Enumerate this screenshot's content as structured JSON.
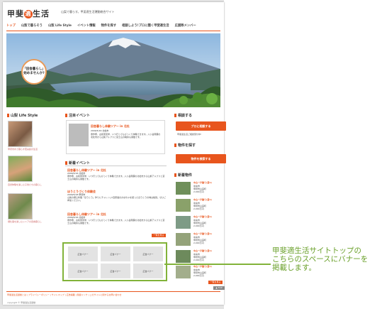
{
  "site": {
    "logo_text": "甲斐適生活",
    "logo_dot_char": "適",
    "tagline": "山梨で暮らす。甲斐適生活運動総合サイト"
  },
  "nav": [
    "トップ",
    "山梨で暮らそう",
    "山梨 Life Style",
    "イベント情報",
    "物件を探す",
    "相談しよう!プロに聞く甲斐適生活",
    "広援隊メンバー"
  ],
  "hero": {
    "badge_line1": "「田舎暮らし」",
    "badge_line2": "始めませんか?"
  },
  "left": {
    "heading": "山梨 Life Style",
    "captions": [
      "甲府市内で暮らす若夫婦の生活",
      "自然体験を楽しむ子供たちの暮らし",
      "畑仕事を楽しむシニアの田舎暮らし"
    ]
  },
  "featured": {
    "heading": "注目イベント",
    "title": "田舎暮らし体験ツアー in 北杜",
    "meta": "2009/5/16  北杜市",
    "text": "豊作祭、古民家見学、いつ行ってもびっくり体験できます。八ヶ岳南麓の北杜市から山梨アルプスと富士山の眺めも素敵です。"
  },
  "new_events": {
    "heading": "新着イベント",
    "items": [
      {
        "title": "田舎暮らし体験ツアー in 北杜",
        "meta": "2009/5/16  北杜市",
        "text": "豊作祭、古民家見学、いつ行ってもびっくり体験できます。八ヶ岳南麓の北杜市から山梨アルプスと富士山の眺めも素敵です。"
      },
      {
        "title": "ほうとうづくり体験会",
        "meta": "2009/5/18  甲府市",
        "text": "山梨の郷土料理「ほうとう」作りにチャレンジ!自家製のかぼちゃを使ったほうとうの味は格別。ぜひご参加ください。"
      },
      {
        "title": "田舎暮らし体験ツアー in 北杜",
        "meta": "2009/5/16  北杜市",
        "text": "豊作祭、古民家見学、いつ行ってもびっくり体験できます。八ヶ岳南麓の北杜市から山梨アルプスと富士山の眺めも素敵です。"
      }
    ],
    "more": "一覧を見る"
  },
  "banners": [
    "広告バナー",
    "広告バナー",
    "広告バナー",
    "広告バナー",
    "広告バナー",
    "広告バナー"
  ],
  "right": {
    "consult_heading": "相談する",
    "consult_button": "プロに相談する",
    "consult_sub": "甲斐適生活ご相談受付中!",
    "search_heading": "物件を探す",
    "search_button": "物件を検索する",
    "new_heading": "新着物件",
    "properties": [
      {
        "title": "中古一戸建て(貸1)",
        "lines": [
          "中央市",
          "甲府市山宮町",
          "2,000万円"
        ]
      },
      {
        "title": "中古一戸建て(貸1)",
        "lines": [
          "中央市",
          "甲府市山宮町",
          "2,000万円"
        ]
      },
      {
        "title": "中古一戸建て(貸1)",
        "lines": [
          "中央市",
          "甲府市山宮町",
          "2,000万円"
        ]
      },
      {
        "title": "中古一戸建て(貸1)",
        "lines": [
          "中央市",
          "甲府市山宮町",
          "2,000万円"
        ]
      },
      {
        "title": "中古一戸建て(貸1)",
        "lines": [
          "中央市",
          "甲府市山宮町",
          "2,000万円"
        ]
      },
      {
        "title": "中古一戸建て(貸1)",
        "lines": [
          "中央市",
          "甲府市山宮町",
          "2,000万円"
        ]
      }
    ],
    "more": "一覧を見る"
  },
  "footer": {
    "links": "甲斐適生活運動とは | プライバシーポリシー | サイトマップ | 広告掲載 | 関連リンク | このサイトに関するお問い合わせ",
    "copyright": "copyright © 甲斐適生活運動",
    "top": "▲ TOP"
  },
  "callout": {
    "line1": "甲斐適生活サイトトップの",
    "line2": "こちらのスペースにバナーを",
    "line3": "掲載します。"
  },
  "colors": {
    "accent": "#e8551d",
    "callout_green": "#82b33a"
  }
}
